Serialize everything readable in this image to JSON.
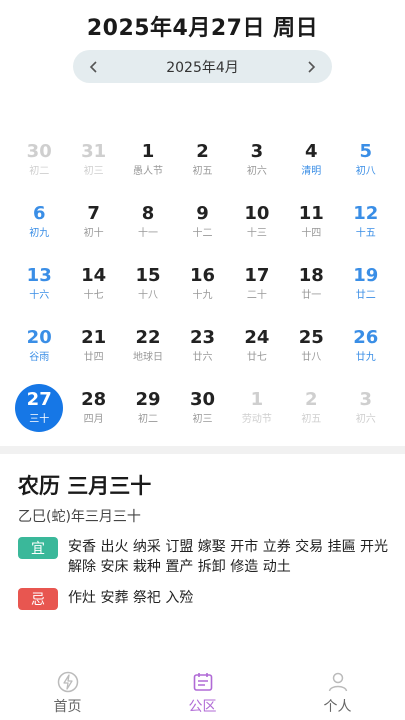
{
  "header": {
    "title": "2025年4月27日 周日"
  },
  "month_nav": {
    "label": "2025年4月"
  },
  "calendar": {
    "rows": [
      [
        {
          "d": "30",
          "l": "初二",
          "type": "other"
        },
        {
          "d": "31",
          "l": "初三",
          "type": "other"
        },
        {
          "d": "1",
          "l": "愚人节",
          "type": "normal"
        },
        {
          "d": "2",
          "l": "初五",
          "type": "normal"
        },
        {
          "d": "3",
          "l": "初六",
          "type": "normal"
        },
        {
          "d": "4",
          "l": "清明",
          "type": "holiday"
        },
        {
          "d": "5",
          "l": "初八",
          "type": "weekend"
        }
      ],
      [
        {
          "d": "6",
          "l": "初九",
          "type": "weekend"
        },
        {
          "d": "7",
          "l": "初十",
          "type": "normal"
        },
        {
          "d": "8",
          "l": "十一",
          "type": "normal"
        },
        {
          "d": "9",
          "l": "十二",
          "type": "normal"
        },
        {
          "d": "10",
          "l": "十三",
          "type": "normal"
        },
        {
          "d": "11",
          "l": "十四",
          "type": "normal"
        },
        {
          "d": "12",
          "l": "十五",
          "type": "weekend"
        }
      ],
      [
        {
          "d": "13",
          "l": "十六",
          "type": "weekend"
        },
        {
          "d": "14",
          "l": "十七",
          "type": "normal"
        },
        {
          "d": "15",
          "l": "十八",
          "type": "normal"
        },
        {
          "d": "16",
          "l": "十九",
          "type": "normal"
        },
        {
          "d": "17",
          "l": "二十",
          "type": "normal"
        },
        {
          "d": "18",
          "l": "廿一",
          "type": "normal"
        },
        {
          "d": "19",
          "l": "廿二",
          "type": "weekend"
        }
      ],
      [
        {
          "d": "20",
          "l": "谷雨",
          "type": "weekend"
        },
        {
          "d": "21",
          "l": "廿四",
          "type": "normal"
        },
        {
          "d": "22",
          "l": "地球日",
          "type": "normal"
        },
        {
          "d": "23",
          "l": "廿六",
          "type": "normal"
        },
        {
          "d": "24",
          "l": "廿七",
          "type": "normal"
        },
        {
          "d": "25",
          "l": "廿八",
          "type": "normal"
        },
        {
          "d": "26",
          "l": "廿九",
          "type": "weekend"
        }
      ],
      [
        {
          "d": "27",
          "l": "三十",
          "type": "selected"
        },
        {
          "d": "28",
          "l": "四月",
          "type": "normal"
        },
        {
          "d": "29",
          "l": "初二",
          "type": "normal"
        },
        {
          "d": "30",
          "l": "初三",
          "type": "normal"
        },
        {
          "d": "1",
          "l": "劳动节",
          "type": "other"
        },
        {
          "d": "2",
          "l": "初五",
          "type": "other"
        },
        {
          "d": "3",
          "l": "初六",
          "type": "other"
        }
      ]
    ]
  },
  "detail": {
    "lunar_date": "农历 三月三十",
    "ganzhi": "乙巳(蛇)年三月三十",
    "yi_label": "宜",
    "yi_items": "安香 出火 纳采 订盟 嫁娶 开市 立券 交易 挂匾 开光 解除 安床 栽种 置产 拆卸 修造 动土",
    "ji_label": "忌",
    "ji_items": "作灶 安葬 祭祀 入殓"
  },
  "tabbar": {
    "tabs": [
      {
        "label": "首页",
        "icon": "lightning-icon"
      },
      {
        "label": "公区",
        "icon": "calendar-icon"
      },
      {
        "label": "个人",
        "icon": "person-icon"
      }
    ]
  },
  "colors": {
    "accent": "#1677e6",
    "weekend": "#3a8ee6",
    "yi": "#3ab89a",
    "ji": "#e85650",
    "tab_active": "#b06ad6"
  }
}
